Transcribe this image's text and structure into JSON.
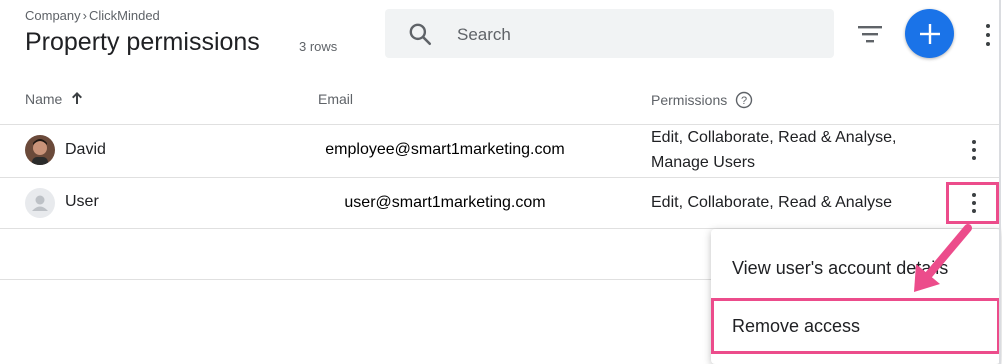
{
  "header": {
    "breadcrumb": [
      "Company",
      "ClickMinded"
    ],
    "breadcrumb_separator": "›",
    "title": "Property permissions",
    "row_count": "3 rows"
  },
  "search": {
    "placeholder": "Search"
  },
  "toolbar": {
    "filter_icon": "filter-icon",
    "add_button_icon": "plus-icon",
    "more_icon": "more-vert-icon",
    "accent_color": "#1a73e8"
  },
  "table": {
    "columns": [
      {
        "label": "Name",
        "sort": "ascending"
      },
      {
        "label": "Email"
      },
      {
        "label": "Permissions",
        "help_icon": "help-circle-icon"
      }
    ],
    "rows": [
      {
        "name": "David",
        "avatar": "photo",
        "email": "employee@smart1marketing.com",
        "permissions": [
          "Edit, Collaborate, Read & Analyse,",
          "Manage Users"
        ]
      },
      {
        "name": "User",
        "avatar": "default-person-icon",
        "email": "user@smart1marketing.com",
        "permissions": [
          "Edit, Collaborate, Read & Analyse"
        ]
      }
    ]
  },
  "context_menu": {
    "items": [
      {
        "label": "View user's account details"
      },
      {
        "label": "Remove access",
        "highlighted": true
      }
    ]
  },
  "annotation": {
    "color": "#ec4c8b"
  }
}
